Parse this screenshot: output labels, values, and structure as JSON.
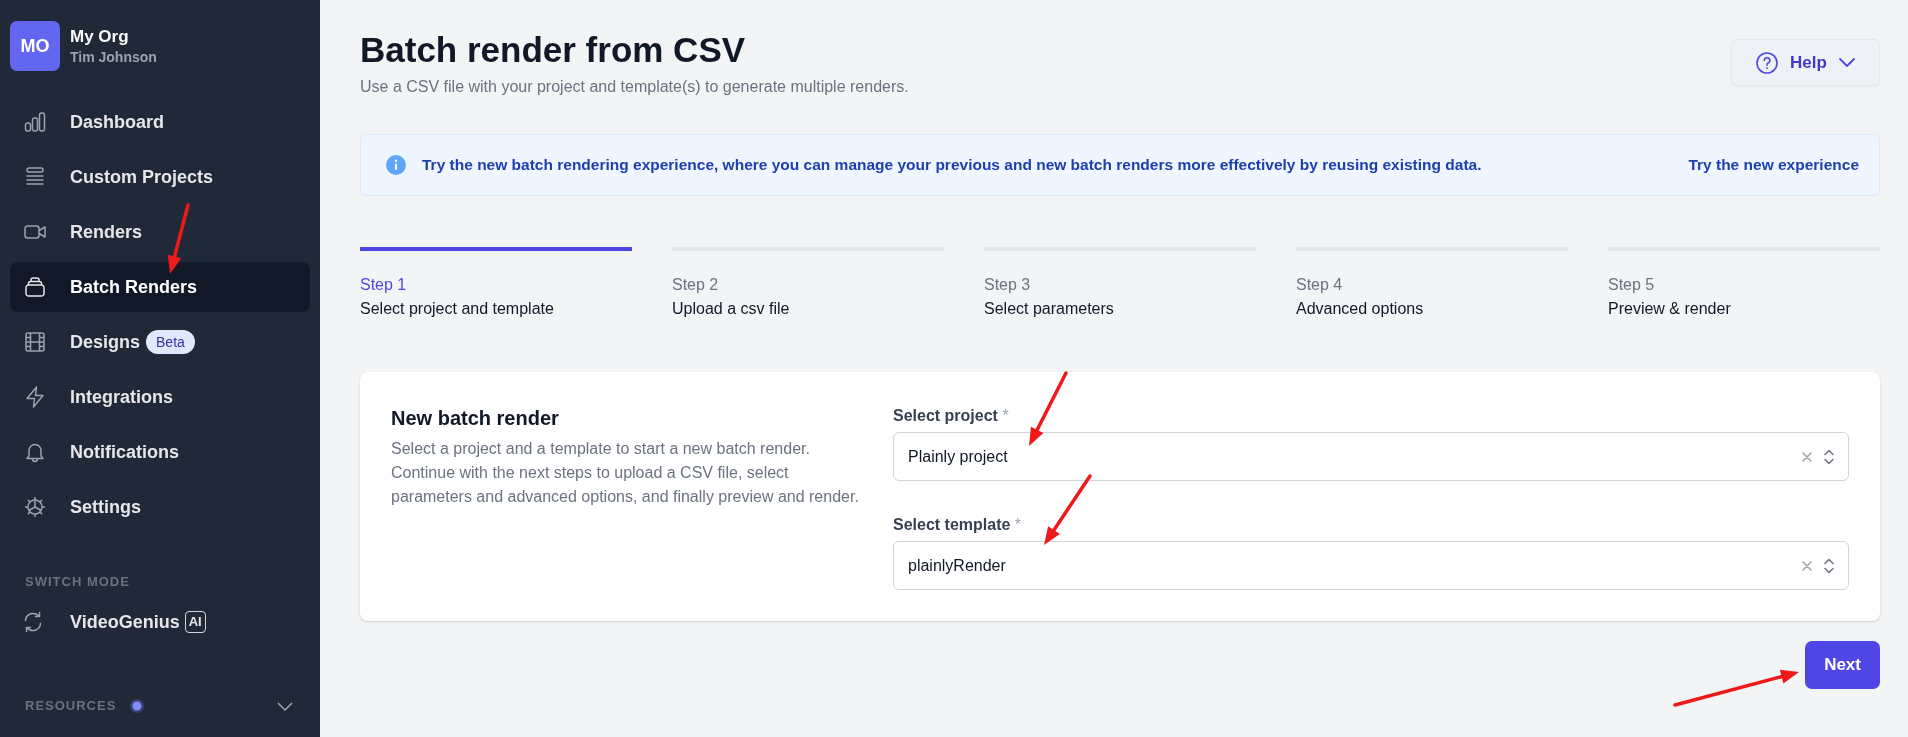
{
  "sidebar": {
    "org": {
      "initials": "MO",
      "name": "My Org",
      "user": "Tim Johnson"
    },
    "items": [
      {
        "label": "Dashboard",
        "selected": false
      },
      {
        "label": "Custom Projects",
        "selected": false
      },
      {
        "label": "Renders",
        "selected": false
      },
      {
        "label": "Batch Renders",
        "selected": true
      },
      {
        "label": "Designs",
        "badge": "Beta",
        "selected": false
      },
      {
        "label": "Integrations",
        "selected": false
      },
      {
        "label": "Notifications",
        "selected": false
      },
      {
        "label": "Settings",
        "selected": false
      }
    ],
    "switch_mode": {
      "heading": "SWITCH MODE",
      "label": "VideoGenius",
      "badge": "AI"
    },
    "resources": {
      "heading": "RESOURCES",
      "expanded": false
    }
  },
  "header": {
    "title": "Batch render from CSV",
    "subtitle": "Use a CSV file with your project and template(s) to generate multiple renders.",
    "help_button": "Help"
  },
  "banner": {
    "message": "Try the new batch rendering experience, where you can manage your previous and new batch renders more effectively by reusing existing data.",
    "link": "Try the new experience"
  },
  "steps": [
    {
      "label": "Step 1",
      "name": "Select project and template",
      "selected": true
    },
    {
      "label": "Step 2",
      "name": "Upload a csv file",
      "selected": false
    },
    {
      "label": "Step 3",
      "name": "Select parameters",
      "selected": false
    },
    {
      "label": "Step 4",
      "name": "Advanced options",
      "selected": false
    },
    {
      "label": "Step 5",
      "name": "Preview & render",
      "selected": false
    }
  ],
  "form": {
    "title": "New batch render",
    "description": "Select a project and a template to start a new batch render. Continue with the next steps to upload a CSV file, select parameters and advanced options, and finally preview and render.",
    "fields": [
      {
        "label": "Select project",
        "required_mark": "*",
        "value": "Plainly project"
      },
      {
        "label": "Select template",
        "required_mark": "*",
        "value": "plainlyRender"
      }
    ]
  },
  "next_button": "Next"
}
